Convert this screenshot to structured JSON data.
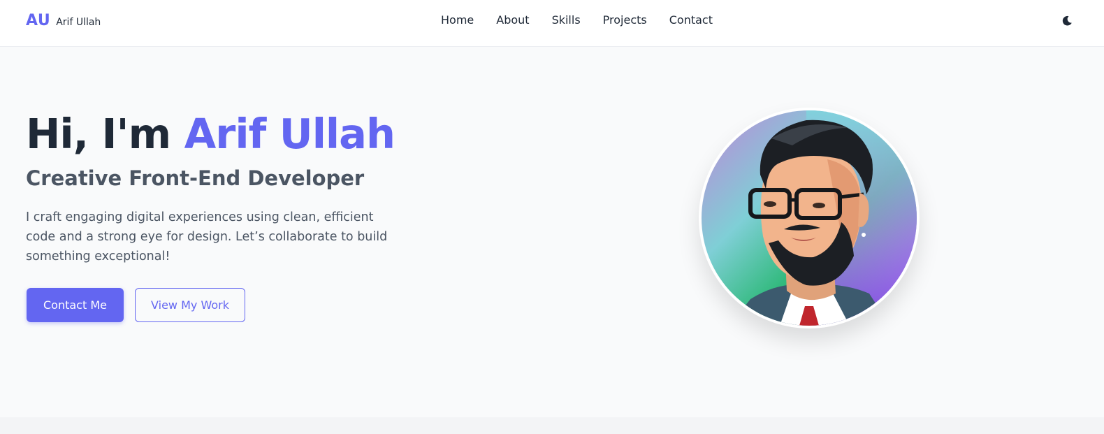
{
  "brand": {
    "initials": "AU",
    "name": "Arif Ullah"
  },
  "nav": {
    "items": [
      {
        "label": "Home"
      },
      {
        "label": "About"
      },
      {
        "label": "Skills"
      },
      {
        "label": "Projects"
      },
      {
        "label": "Contact"
      }
    ],
    "theme_toggle_icon": "moon-icon"
  },
  "hero": {
    "greeting": "Hi, I'm",
    "name": "Arif Ullah",
    "subtitle": "Creative Front-End Developer",
    "description": "I craft engaging digital experiences using clean, efficient code and a strong eye for design. Let’s collaborate to build something exceptional!",
    "primary_button": "Contact Me",
    "secondary_button": "View My Work"
  },
  "colors": {
    "accent": "#6366f1",
    "heading": "#1f2937",
    "body_text": "#4b5563",
    "background": "#f9fafb"
  }
}
